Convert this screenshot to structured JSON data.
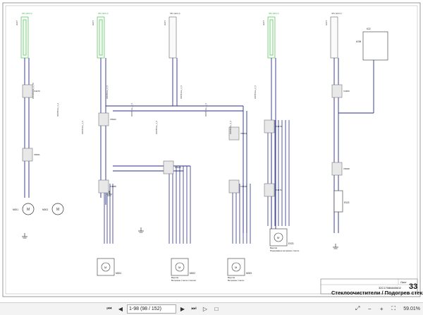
{
  "document": {
    "title": "Стеклоочистители / Подогрев стекла",
    "page_number": "33",
    "sheet_label": "Лист",
    "doc_number": "32C17086840602"
  },
  "viewer": {
    "page_indicator": "1-98 (98 / 152)",
    "zoom": "59.01%"
  },
  "icons": {
    "first": "first-page-icon",
    "prev": "previous-page-icon",
    "next": "next-page-icon",
    "last": "last-page-icon",
    "play": "play-icon",
    "stop": "stop-icon",
    "fit": "fit-page-icon",
    "zoom_out": "zoom-out-icon",
    "zoom_in": "zoom-in-icon",
    "fullscreen": "fullscreen-icon",
    "settings": "gear-icon"
  },
  "schematic": {
    "fuse_labels": [
      "36V (ECU)",
      "36V (ECU)",
      "36V (ECU)",
      "36V (ECU)",
      "36V (ECU)"
    ],
    "ref_labels": [
      "A147",
      "A147",
      "A147",
      "A147",
      "A147"
    ],
    "connector_labels": [
      "X4470",
      "X5001",
      "X5002",
      "X4388",
      "X4324",
      "X5004",
      "X4530",
      "X4473",
      "X4471",
      "X4483",
      "X5008",
      "X4473",
      "X5003"
    ],
    "component_labels": [
      "M001",
      "M003",
      "M004",
      "M002",
      "M005",
      "E023",
      "A154",
      "K22"
    ],
    "captions": [
      {
        "ref": "M004",
        "text": ""
      },
      {
        "ref": "M002",
        "text": "Ветровое стекло стеклоп"
      },
      {
        "ref": "M003",
        "text": "Ветровое стекло"
      },
      {
        "ref": "M005",
        "text": "Панорамное ветровое стекло"
      }
    ],
    "variant_labels": [
      "Версия",
      "Версия",
      "Версия"
    ],
    "wire_labels": [
      "WF6294.be_3_7R",
      "W6050.be_1_6",
      "W6051.be_1_5",
      "W6050.be_2_5",
      "W6051.be_2_5",
      "W6050.be_1_5",
      "W6051.be_1_5",
      "W6051.be_3_5",
      "W6050.be_3_3",
      "W6051.be_2_5"
    ],
    "misc_labels": [
      "Лист",
      "Ляфт",
      "A147"
    ],
    "accent_colors": {
      "wire_blue": "#2a2f86",
      "fuse_green": "#3cb24a",
      "fuse_blue": "#5b8ad8",
      "connector_grey": "#888888"
    }
  }
}
